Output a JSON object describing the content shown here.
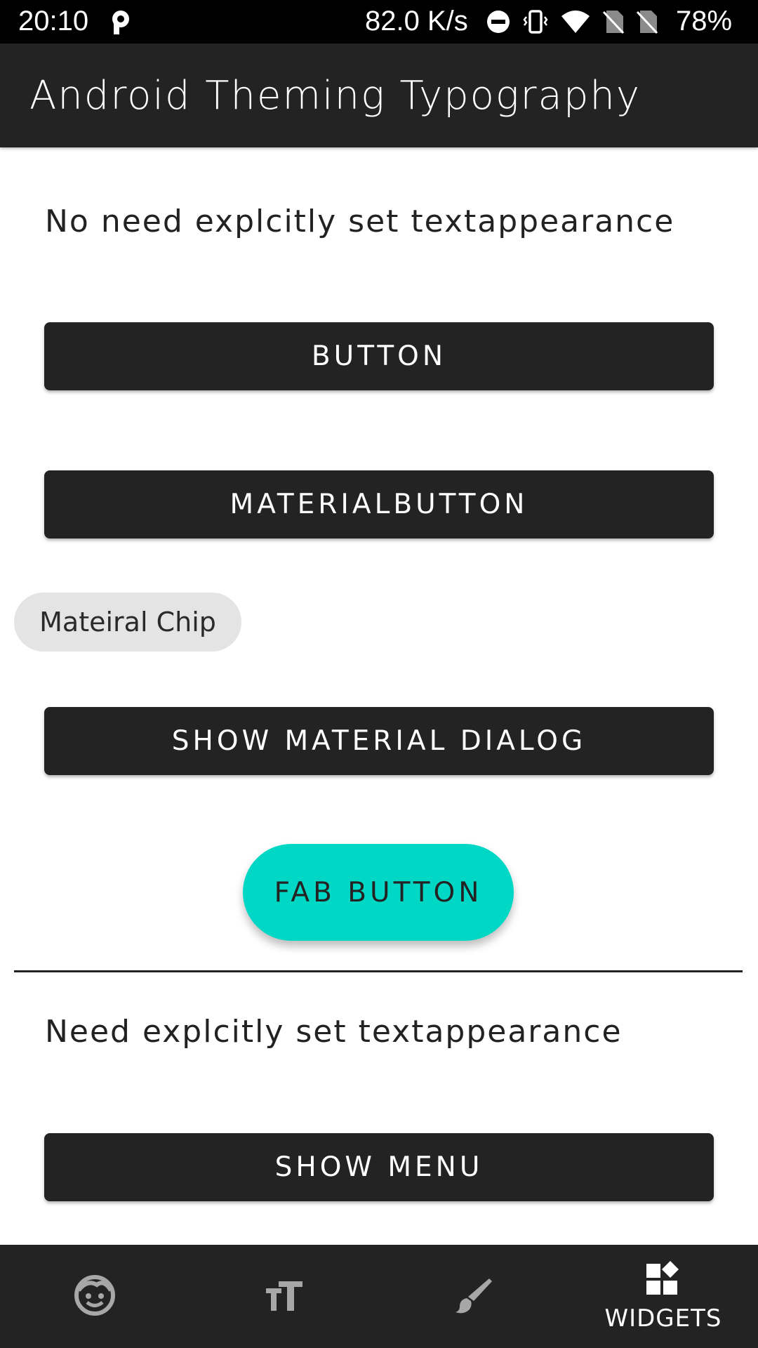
{
  "status_bar": {
    "time": "20:10",
    "speed": "82.0 K/s",
    "battery": "78%",
    "icons": [
      "parking-icon",
      "do-not-disturb-icon",
      "vibrate-icon",
      "wifi-icon",
      "no-sim-icon",
      "no-sim-icon",
      "battery-icon"
    ]
  },
  "app_bar": {
    "title": "Android Theming Typography"
  },
  "content": {
    "section1_text": "No need explcitly set textappearance",
    "button_label": "BUTTON",
    "material_button_label": "MATERIALBUTTON",
    "chip_label": "Mateiral Chip",
    "dialog_button_label": "SHOW MATERIAL DIALOG",
    "fab_label": "FAB BUTTON",
    "section2_text": "Need explcitly set textappearance",
    "menu_button_label": "SHOW MENU"
  },
  "bottom_nav": {
    "items": [
      {
        "icon": "face-icon",
        "label": ""
      },
      {
        "icon": "text-size-icon",
        "label": ""
      },
      {
        "icon": "brush-icon",
        "label": ""
      },
      {
        "icon": "widgets-icon",
        "label": "WIDGETS",
        "selected": true
      }
    ]
  },
  "colors": {
    "dark_surface": "#232323",
    "accent": "#00d7c5",
    "chip_bg": "#e4e4e4",
    "icon_inactive": "#a7a7a7"
  }
}
